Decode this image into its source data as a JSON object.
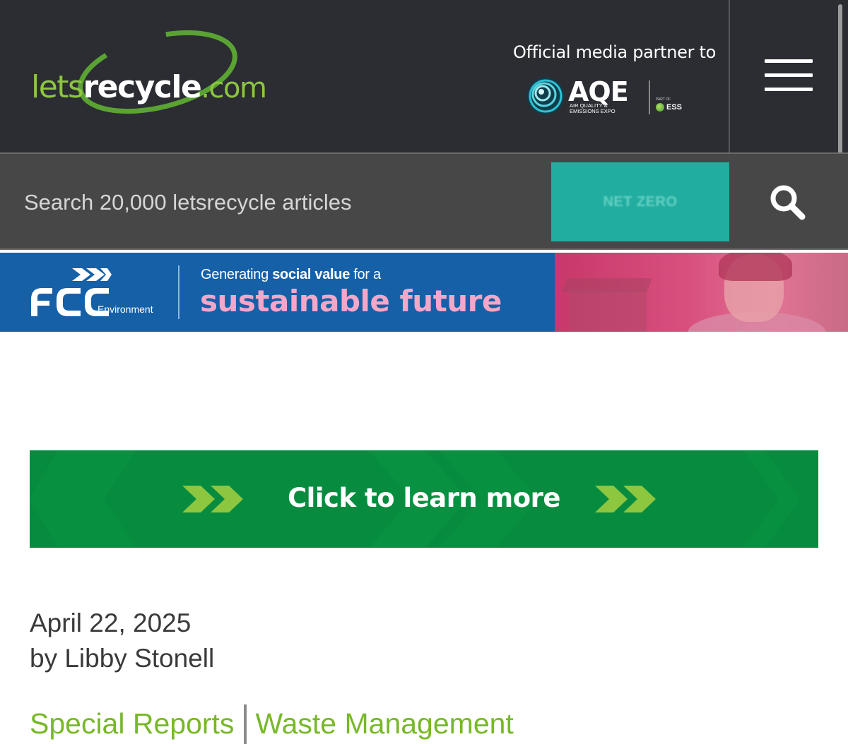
{
  "header": {
    "logo": {
      "part1": "lets",
      "part2": "recycle",
      "part3": ".com"
    },
    "partner_label": "Official media partner to",
    "aqe": {
      "name": "AQE",
      "subtitle_line1": "AIR QUALITY &",
      "subtitle_line2": "EMISSIONS EXPO",
      "part_of": "PART OF",
      "ess": "ESS"
    },
    "menu_icon": "hamburger-menu-icon"
  },
  "search": {
    "placeholder": "Search 20,000 letsrecycle articles",
    "promo_label": "NET ZERO",
    "button_icon": "search-icon",
    "promo_color": "#21ada0"
  },
  "fcc_banner": {
    "logo": "FCC",
    "logo_sub": "Environment",
    "line1_pre": "Generating ",
    "line1_bold": "social value",
    "line1_post": " for a",
    "line2": "sustainable future"
  },
  "cta_banner": {
    "label": "Click to learn more",
    "color": "#078c3f"
  },
  "article": {
    "date": "April 22, 2025",
    "author": "by Libby Stonell",
    "categories": [
      "Special Reports",
      "Waste Management"
    ],
    "category_color": "#78b829"
  }
}
